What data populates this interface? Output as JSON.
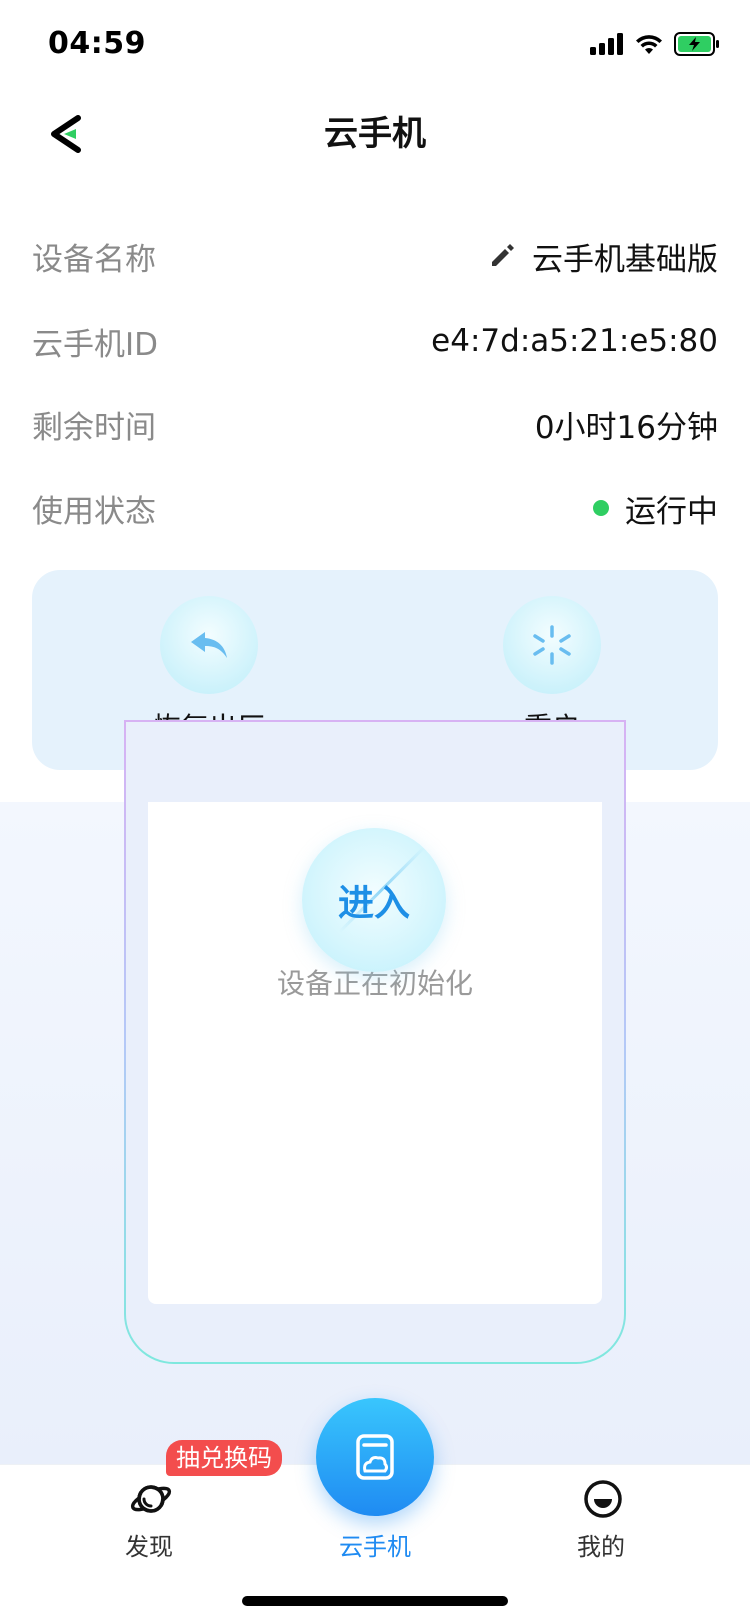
{
  "status_bar": {
    "time": "04:59"
  },
  "nav": {
    "title": "云手机"
  },
  "info_rows": [
    {
      "label": "设备名称",
      "value": "云手机基础版"
    },
    {
      "label": "云手机ID",
      "value": "e4:7d:a5:21:e5:80"
    },
    {
      "label": "剩余时间",
      "value": "0小时16分钟"
    },
    {
      "label": "使用状态",
      "value": "运行中"
    }
  ],
  "actions": {
    "reset_label": "恢复出厂",
    "restart_label": "重启"
  },
  "phone": {
    "status_text": "设备正在初始化",
    "enter_label": "进入"
  },
  "tabs": {
    "discover": "发现",
    "cloud_phone": "云手机",
    "mine": "我的",
    "promo_badge": "抽兑换码"
  },
  "colors": {
    "accent": "#1F8BF2",
    "status_running": "#2FCE62",
    "badge": "#F34D4D",
    "panel_bg": "#E5F2FC"
  }
}
